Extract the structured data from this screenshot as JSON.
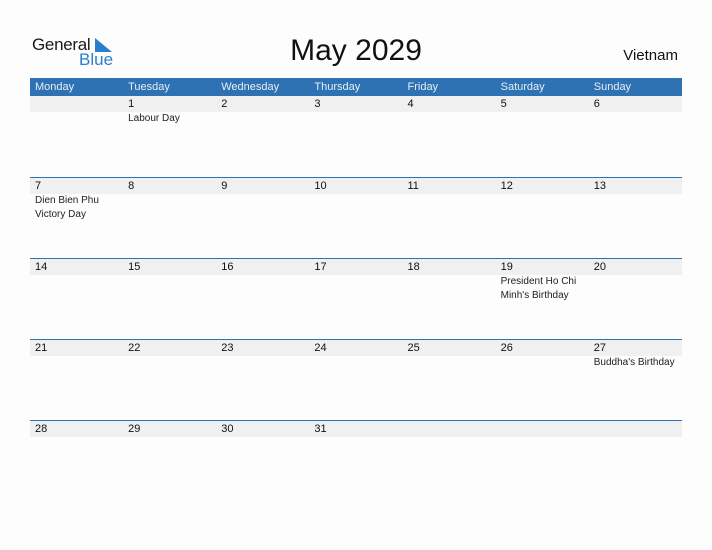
{
  "logo": {
    "text_general": "General",
    "text_blue": "Blue",
    "accent": "#2a7fc9"
  },
  "title": "May 2029",
  "country": "Vietnam",
  "colors": {
    "header_bg": "#2e72b4",
    "date_band": "#f0f0f0"
  },
  "weekdays": [
    "Monday",
    "Tuesday",
    "Wednesday",
    "Thursday",
    "Friday",
    "Saturday",
    "Sunday"
  ],
  "weeks": [
    [
      {
        "day": "",
        "event": ""
      },
      {
        "day": "1",
        "event": "Labour Day"
      },
      {
        "day": "2",
        "event": ""
      },
      {
        "day": "3",
        "event": ""
      },
      {
        "day": "4",
        "event": ""
      },
      {
        "day": "5",
        "event": ""
      },
      {
        "day": "6",
        "event": ""
      }
    ],
    [
      {
        "day": "7",
        "event": "Dien Bien Phu Victory Day"
      },
      {
        "day": "8",
        "event": ""
      },
      {
        "day": "9",
        "event": ""
      },
      {
        "day": "10",
        "event": ""
      },
      {
        "day": "11",
        "event": ""
      },
      {
        "day": "12",
        "event": ""
      },
      {
        "day": "13",
        "event": ""
      }
    ],
    [
      {
        "day": "14",
        "event": ""
      },
      {
        "day": "15",
        "event": ""
      },
      {
        "day": "16",
        "event": ""
      },
      {
        "day": "17",
        "event": ""
      },
      {
        "day": "18",
        "event": ""
      },
      {
        "day": "19",
        "event": "President Ho Chi Minh's Birthday"
      },
      {
        "day": "20",
        "event": ""
      }
    ],
    [
      {
        "day": "21",
        "event": ""
      },
      {
        "day": "22",
        "event": ""
      },
      {
        "day": "23",
        "event": ""
      },
      {
        "day": "24",
        "event": ""
      },
      {
        "day": "25",
        "event": ""
      },
      {
        "day": "26",
        "event": ""
      },
      {
        "day": "27",
        "event": "Buddha's Birthday"
      }
    ],
    [
      {
        "day": "28",
        "event": ""
      },
      {
        "day": "29",
        "event": ""
      },
      {
        "day": "30",
        "event": ""
      },
      {
        "day": "31",
        "event": ""
      },
      {
        "day": "",
        "event": ""
      },
      {
        "day": "",
        "event": ""
      },
      {
        "day": "",
        "event": ""
      }
    ]
  ]
}
